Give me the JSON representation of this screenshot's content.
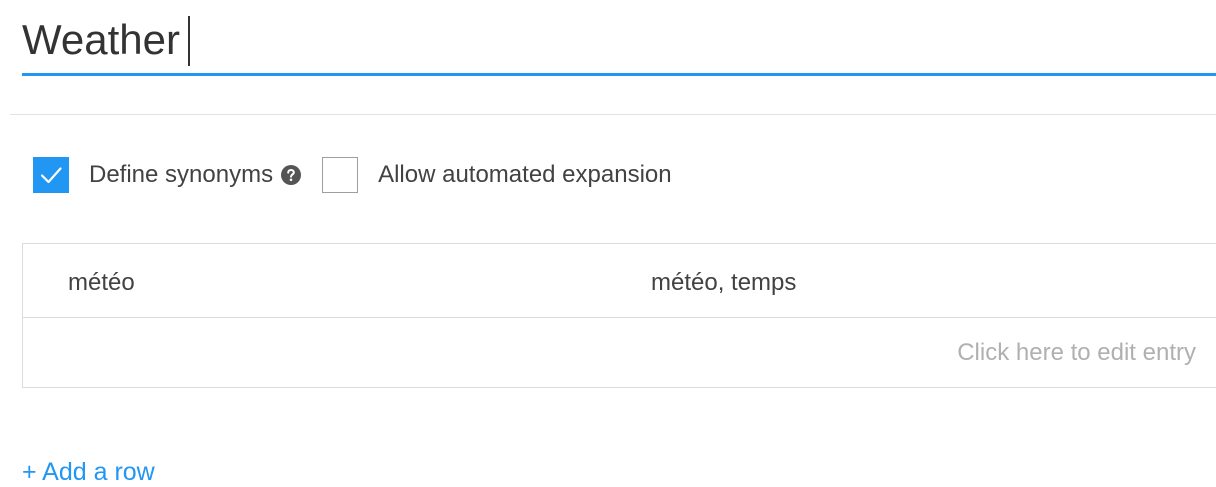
{
  "entity": {
    "name_value": "Weather"
  },
  "options": {
    "define_synonyms": {
      "label": "Define synonyms",
      "checked": true,
      "help_icon": "question-circle-icon"
    },
    "automated_expansion": {
      "label": "Allow automated expansion",
      "checked": false
    }
  },
  "entries": {
    "rows": [
      {
        "value": "météo",
        "synonyms": "météo, temps"
      }
    ],
    "edit_placeholder": "Click here to edit entry"
  },
  "actions": {
    "add_row_label": "+ Add a row"
  },
  "colors": {
    "accent": "#2196f3",
    "border": "#dcdcdc",
    "placeholder": "#b0b0b0"
  }
}
